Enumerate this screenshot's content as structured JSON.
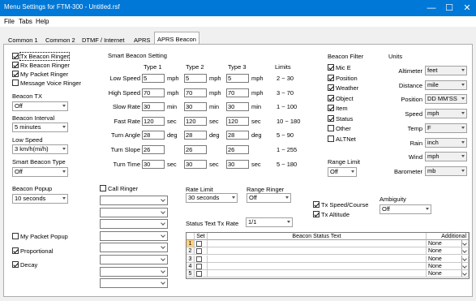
{
  "window": {
    "title": "Menu Settings for FTM-300 - Untitled.rsf",
    "min": "—",
    "max": "☐",
    "close": "✕"
  },
  "menu": [
    "File",
    "Tabs",
    "Help"
  ],
  "tabs": [
    "Common 1",
    "Common 2",
    "DTMF / Internet",
    "APRS",
    "APRS Beacon"
  ],
  "left": {
    "checks": [
      {
        "label": "Tx Beacon Ringer",
        "checked": true
      },
      {
        "label": "Rx Beacon Ringer",
        "checked": true
      },
      {
        "label": "My Packet Ringer",
        "checked": true
      },
      {
        "label": "Message Voice Ringer",
        "checked": false
      }
    ],
    "beacon_tx_label": "Beacon TX",
    "beacon_tx": "Off",
    "beacon_interval_label": "Beacon Interval",
    "beacon_interval": "5 minutes",
    "low_speed_label": "Low Speed",
    "low_speed": "3 km/h(mi/h)",
    "smart_beacon_type_label": "Smart Beacon Type",
    "smart_beacon_type": "Off",
    "beacon_popup_label": "Beacon Popup",
    "beacon_popup": "10 seconds",
    "my_packet_popup": "My Packet Popup",
    "proportional": "Proportional",
    "decay": "Decay"
  },
  "smart": {
    "title": "Smart Beacon Setting",
    "headers": [
      "Type 1",
      "Type 2",
      "Type 3",
      "Limits"
    ],
    "rows": [
      {
        "label": "Low Speed",
        "v": [
          "5",
          "5",
          "5"
        ],
        "unit": "mph",
        "limit": "2 ~ 30"
      },
      {
        "label": "High Speed",
        "v": [
          "70",
          "70",
          "70"
        ],
        "unit": "mph",
        "limit": "3 ~ 70"
      },
      {
        "label": "Slow Rate",
        "v": [
          "30",
          "30",
          "30"
        ],
        "unit": "min",
        "limit": "1 ~ 100"
      },
      {
        "label": "Fast Rate",
        "v": [
          "120",
          "120",
          "120"
        ],
        "unit": "sec",
        "limit": "10 ~ 180"
      },
      {
        "label": "Turn Angle",
        "v": [
          "28",
          "28",
          "28"
        ],
        "unit": "deg",
        "limit": "5 ~ 90"
      },
      {
        "label": "Turn Slope",
        "v": [
          "26",
          "26",
          "26"
        ],
        "unit": "",
        "limit": "1 ~ 255"
      },
      {
        "label": "Turn Time",
        "v": [
          "30",
          "30",
          "30"
        ],
        "unit": "sec",
        "limit": "5 ~ 180"
      }
    ]
  },
  "filter": {
    "title": "Beacon Filter",
    "items": [
      {
        "label": "Mic E",
        "checked": true
      },
      {
        "label": "Position",
        "checked": true
      },
      {
        "label": "Weather",
        "checked": true
      },
      {
        "label": "Object",
        "checked": true
      },
      {
        "label": "Item",
        "checked": true
      },
      {
        "label": "Status",
        "checked": true
      },
      {
        "label": "Other",
        "checked": false
      },
      {
        "label": "ALTNet",
        "checked": false
      }
    ],
    "range_limit_label": "Range Limit",
    "range_limit": "Off"
  },
  "units": {
    "title": "Units",
    "rows": [
      {
        "label": "Altimeter",
        "value": "feet"
      },
      {
        "label": "Distance",
        "value": "mile"
      },
      {
        "label": "Position",
        "value": "DD MM'SS"
      },
      {
        "label": "Speed",
        "value": "mph"
      },
      {
        "label": "Temp",
        "value": "F"
      },
      {
        "label": "Rain",
        "value": "inch"
      },
      {
        "label": "Wind",
        "value": "mph"
      },
      {
        "label": "Barometer",
        "value": "mb"
      }
    ]
  },
  "call_ringer": {
    "label": "Call Ringer"
  },
  "rate_limit": {
    "label": "Rate Limit",
    "value": "30 seconds"
  },
  "range_ringer": {
    "label": "Range Ringer",
    "value": "Off"
  },
  "tx_speed": {
    "label": "Tx Speed/Course",
    "checked": true
  },
  "tx_alt": {
    "label": "Tx Altitude",
    "checked": true
  },
  "ambiguity": {
    "label": "Ambiguity",
    "value": "Off"
  },
  "status_rate": {
    "label": "Status Text Tx Rate",
    "value": "1/1"
  },
  "status_grid": {
    "headers": [
      "Set",
      "Beacon Status Text",
      "Additional"
    ],
    "rows": [
      {
        "n": "1",
        "add": "None"
      },
      {
        "n": "2",
        "add": "None"
      },
      {
        "n": "3",
        "add": "None"
      },
      {
        "n": "4",
        "add": "None"
      },
      {
        "n": "5",
        "add": "None"
      }
    ]
  }
}
